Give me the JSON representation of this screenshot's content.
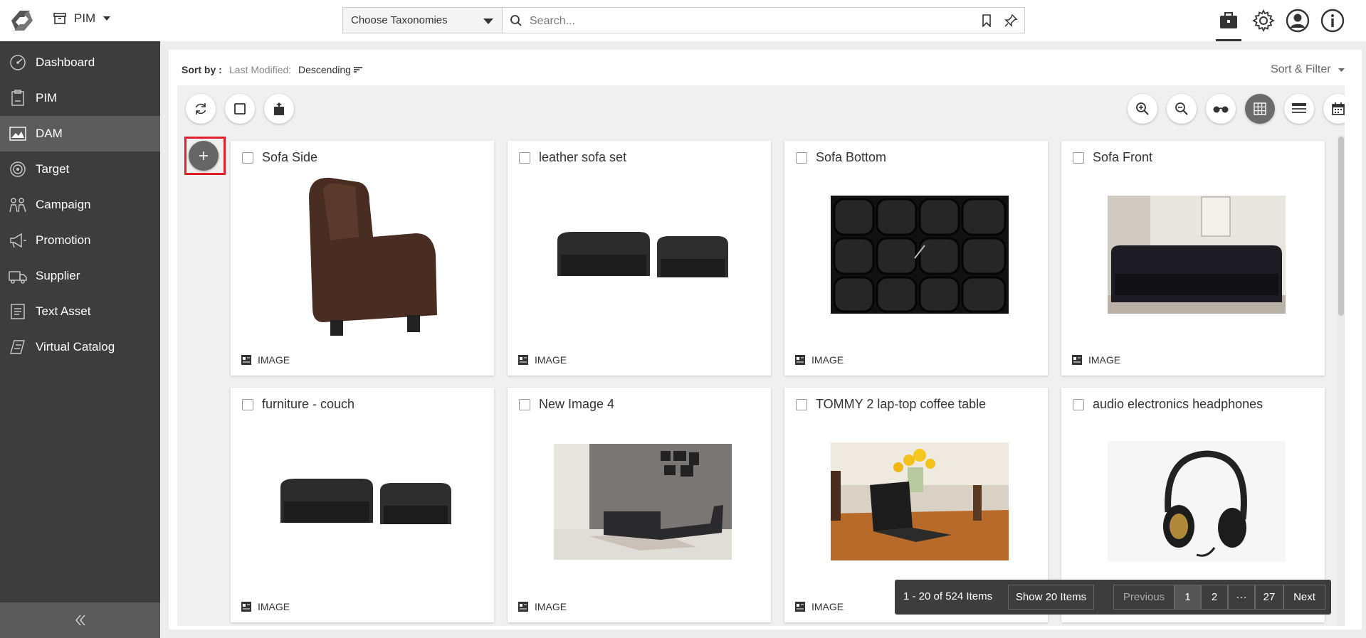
{
  "topbar": {
    "app_name": "PIM",
    "taxonomy_placeholder": "Choose Taxonomies",
    "search_placeholder": "Search..."
  },
  "sidebar": {
    "items": [
      {
        "label": "Dashboard",
        "icon": "dashboard-icon"
      },
      {
        "label": "PIM",
        "icon": "pim-icon"
      },
      {
        "label": "DAM",
        "icon": "dam-icon",
        "active": true
      },
      {
        "label": "Target",
        "icon": "target-icon"
      },
      {
        "label": "Campaign",
        "icon": "campaign-icon"
      },
      {
        "label": "Promotion",
        "icon": "promotion-icon"
      },
      {
        "label": "Supplier",
        "icon": "supplier-icon"
      },
      {
        "label": "Text Asset",
        "icon": "text-asset-icon"
      },
      {
        "label": "Virtual Catalog",
        "icon": "virtual-catalog-icon"
      }
    ]
  },
  "sortbar": {
    "label": "Sort by :",
    "field": "Last Modified:",
    "direction": "Descending",
    "filter_label": "Sort & Filter"
  },
  "cards": [
    {
      "title": "Sofa Side",
      "type": "IMAGE"
    },
    {
      "title": "leather sofa set",
      "type": "IMAGE"
    },
    {
      "title": "Sofa Bottom",
      "type": "IMAGE"
    },
    {
      "title": "Sofa Front",
      "type": "IMAGE"
    },
    {
      "title": "furniture - couch",
      "type": "IMAGE"
    },
    {
      "title": "New Image 4",
      "type": "IMAGE"
    },
    {
      "title": "TOMMY 2 lap-top coffee table",
      "type": "IMAGE"
    },
    {
      "title": "audio electronics headphones",
      "type": "IMAGE"
    }
  ],
  "pager": {
    "count": "1 - 20 of 524 Items",
    "show": "Show 20 Items",
    "previous": "Previous",
    "pages": [
      "1",
      "2",
      "···",
      "27"
    ],
    "next": "Next"
  }
}
